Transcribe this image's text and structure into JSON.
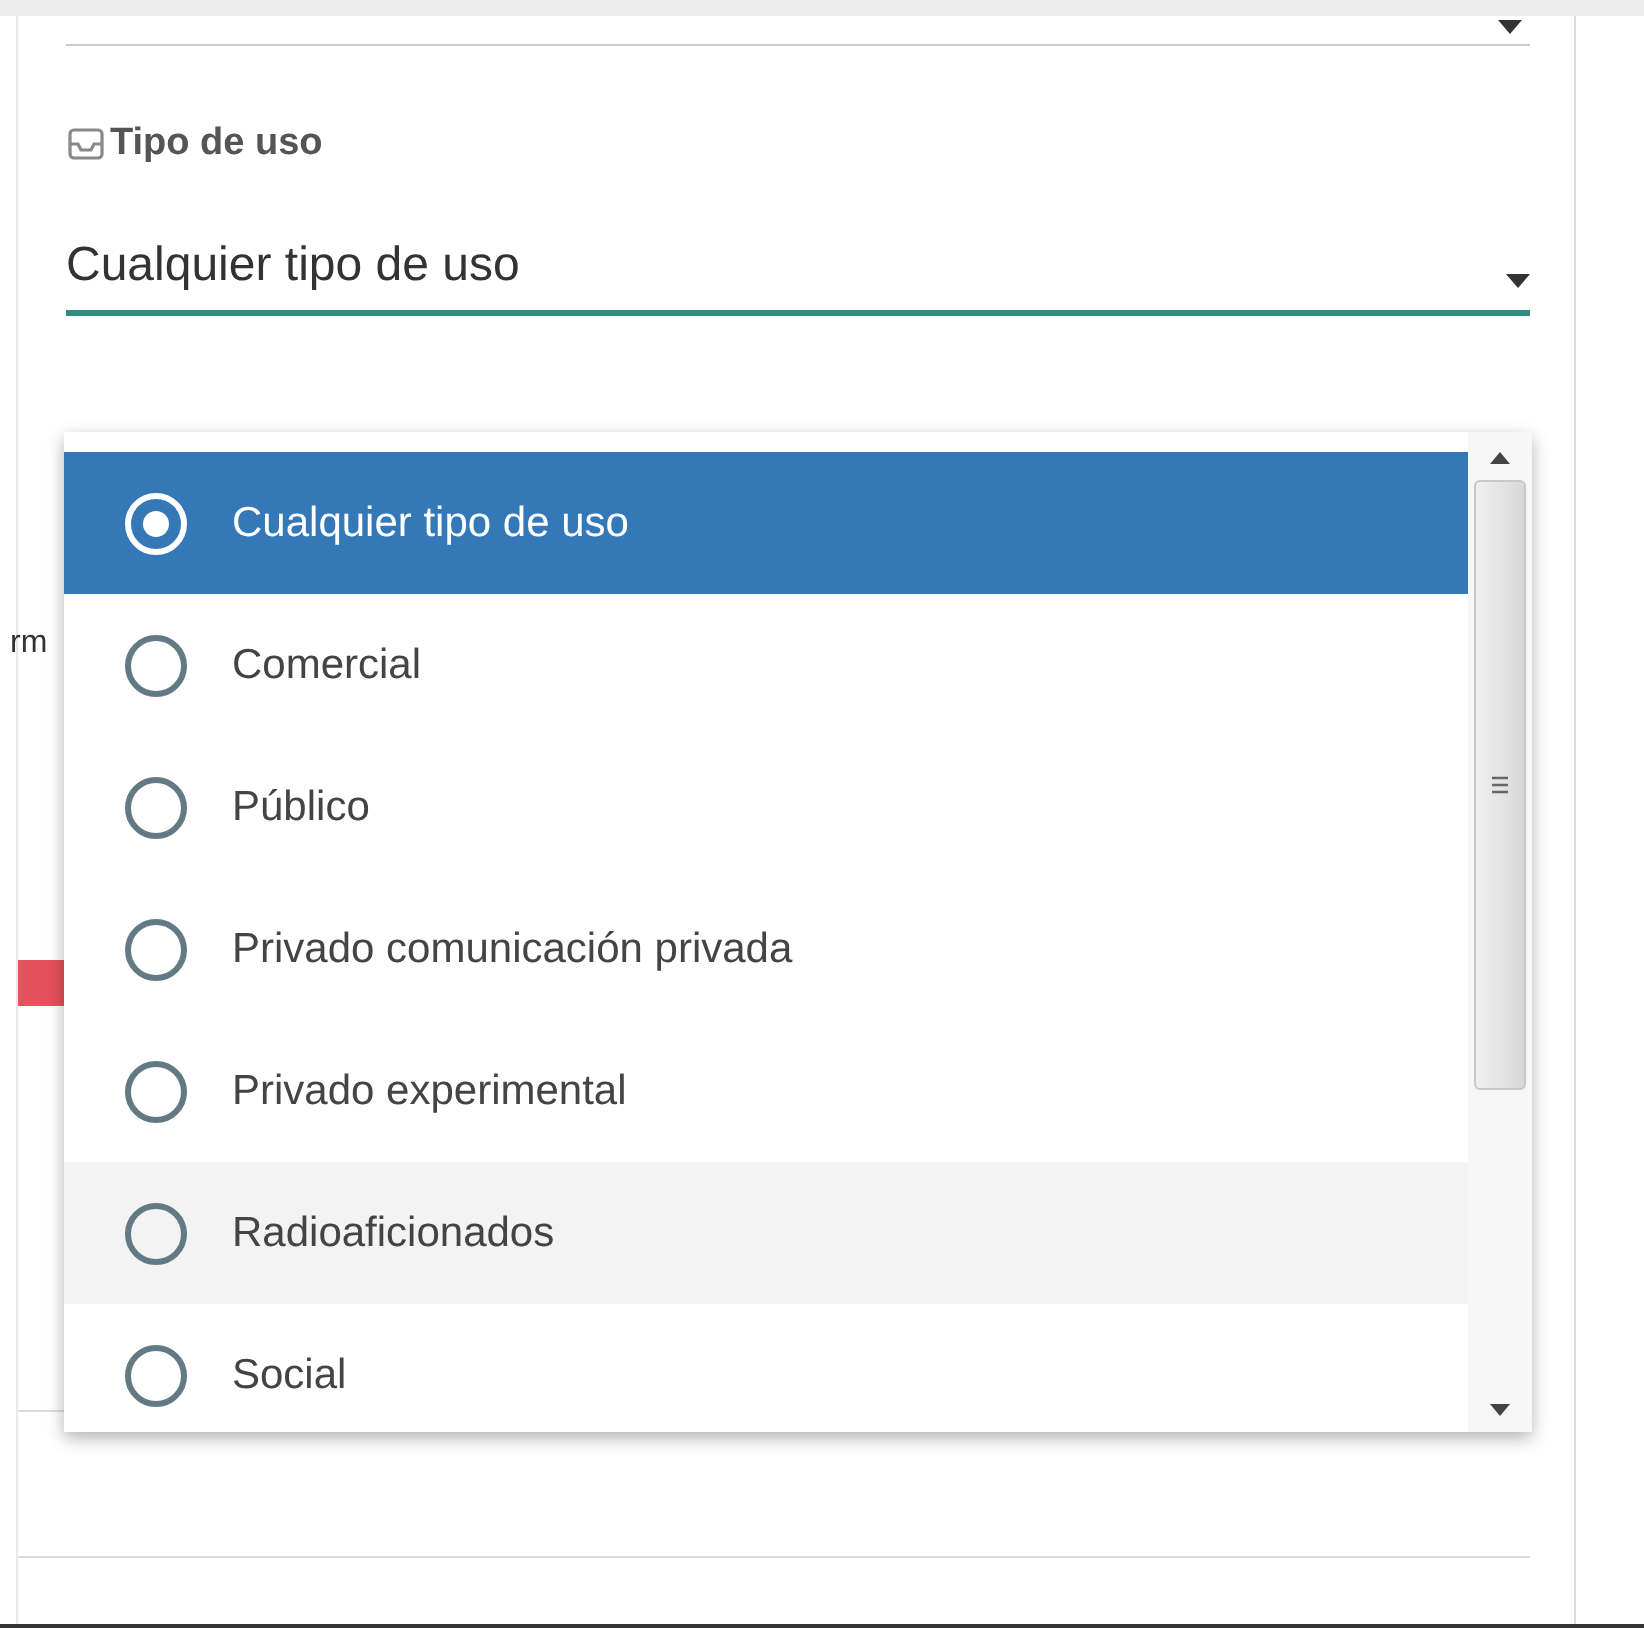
{
  "field": {
    "label": "Tipo de uso",
    "value": "Cualquier tipo de uso",
    "focused": true
  },
  "obscured_text": "rm",
  "dropdown": {
    "options": [
      {
        "label": "Cualquier tipo de uso",
        "selected": true,
        "hovered": false
      },
      {
        "label": "Comercial",
        "selected": false,
        "hovered": false
      },
      {
        "label": "Público",
        "selected": false,
        "hovered": false
      },
      {
        "label": "Privado comunicación privada",
        "selected": false,
        "hovered": false
      },
      {
        "label": "Privado experimental",
        "selected": false,
        "hovered": false
      },
      {
        "label": "Radioaficionados",
        "selected": false,
        "hovered": true
      },
      {
        "label": "Social",
        "selected": false,
        "hovered": false
      }
    ]
  }
}
